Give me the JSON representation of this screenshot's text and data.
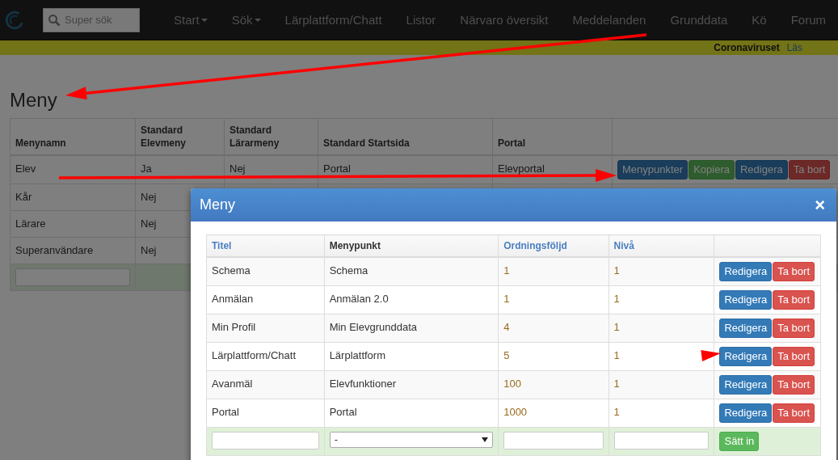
{
  "navbar": {
    "search": {
      "placeholder": "Super sök"
    },
    "items": [
      {
        "label": "Start",
        "dropdown": true
      },
      {
        "label": "Sök",
        "dropdown": true
      },
      {
        "label": "Lärplattform/Chatt",
        "dropdown": false
      },
      {
        "label": "Listor",
        "dropdown": false
      },
      {
        "label": "Närvaro översikt",
        "dropdown": false
      },
      {
        "label": "Meddelanden",
        "dropdown": false
      },
      {
        "label": "Grunddata",
        "dropdown": false
      },
      {
        "label": "Kö",
        "dropdown": false
      },
      {
        "label": "Forum",
        "dropdown": false
      }
    ]
  },
  "notice": {
    "text": "Coronaviruset",
    "link": "Läs"
  },
  "page": {
    "title": "Meny",
    "table": {
      "columns": [
        "Menynamn",
        "Standard Elevmeny",
        "Standard Lärarmeny",
        "Standard Startsida",
        "Portal"
      ],
      "rows": [
        {
          "cells": [
            "Elev",
            "Ja",
            "Nej",
            "Portal",
            "Elevportal"
          ],
          "actions": [
            {
              "label": "Menypunkter",
              "kind": "primary"
            },
            {
              "label": "Kopiera",
              "kind": "success"
            },
            {
              "label": "Redigera",
              "kind": "primary"
            },
            {
              "label": "Ta bort",
              "kind": "danger"
            }
          ]
        },
        {
          "cells": [
            "Kår",
            "Nej"
          ]
        },
        {
          "cells": [
            "Lärare",
            "Nej"
          ]
        },
        {
          "cells": [
            "Superanvändare",
            "Nej"
          ]
        }
      ]
    }
  },
  "modal": {
    "title": "Meny",
    "close": "×",
    "table": {
      "columns": [
        {
          "label": "Titel",
          "sortable": true
        },
        {
          "label": "Menypunkt",
          "sortable": false
        },
        {
          "label": "Ordningsföljd",
          "sortable": true
        },
        {
          "label": "Nivå",
          "sortable": true
        }
      ],
      "rows": [
        {
          "cells": [
            "Schema",
            "Schema",
            "1",
            "1"
          ],
          "actions": [
            {
              "label": "Redigera",
              "kind": "primary"
            },
            {
              "label": "Ta bort",
              "kind": "danger"
            }
          ]
        },
        {
          "cells": [
            "Anmälan",
            "Anmälan 2.0",
            "1",
            "1"
          ],
          "actions": [
            {
              "label": "Redigera",
              "kind": "primary"
            },
            {
              "label": "Ta bort",
              "kind": "danger"
            }
          ]
        },
        {
          "cells": [
            "Min Profil",
            "Min Elevgrunddata",
            "4",
            "1"
          ],
          "actions": [
            {
              "label": "Redigera",
              "kind": "primary"
            },
            {
              "label": "Ta bort",
              "kind": "danger"
            }
          ]
        },
        {
          "cells": [
            "Lärplattform/Chatt",
            "Lärplattform",
            "5",
            "1"
          ],
          "actions": [
            {
              "label": "Redigera",
              "kind": "primary"
            },
            {
              "label": "Ta bort",
              "kind": "danger"
            }
          ]
        },
        {
          "cells": [
            "Avanmäl",
            "Elevfunktioner",
            "100",
            "1"
          ],
          "actions": [
            {
              "label": "Redigera",
              "kind": "primary"
            },
            {
              "label": "Ta bort",
              "kind": "danger"
            }
          ]
        },
        {
          "cells": [
            "Portal",
            "Portal",
            "1000",
            "1"
          ],
          "actions": [
            {
              "label": "Redigera",
              "kind": "primary"
            },
            {
              "label": "Ta bort",
              "kind": "danger"
            }
          ]
        }
      ],
      "insert_row": {
        "select_value": "-",
        "button": {
          "label": "Sätt in",
          "kind": "success"
        }
      }
    }
  }
}
